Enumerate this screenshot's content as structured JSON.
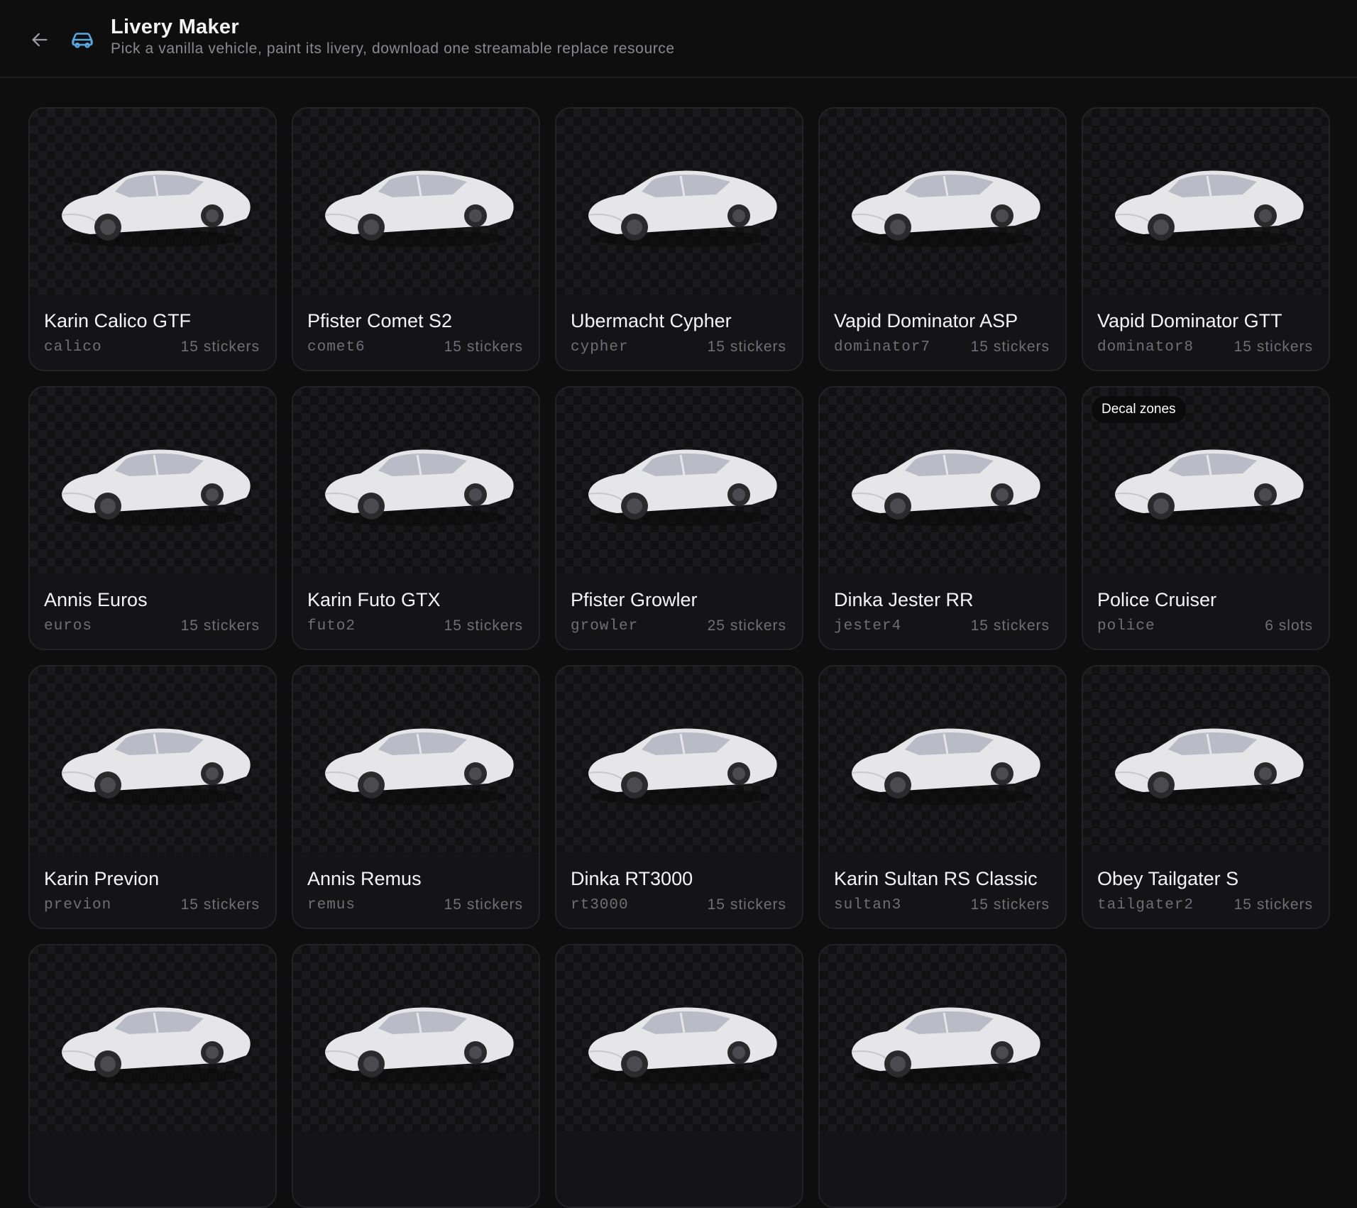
{
  "header": {
    "title": "Livery Maker",
    "subtitle": "Pick a vanilla vehicle, paint its livery, download one streamable replace resource",
    "back_icon": "arrow-left-icon",
    "app_icon": "car-icon",
    "accent_color": "#5aa7e0"
  },
  "vehicles": [
    {
      "name": "Karin Calico GTF",
      "model": "calico",
      "count": "15 stickers",
      "badge": ""
    },
    {
      "name": "Pfister Comet S2",
      "model": "comet6",
      "count": "15 stickers",
      "badge": ""
    },
    {
      "name": "Ubermacht Cypher",
      "model": "cypher",
      "count": "15 stickers",
      "badge": ""
    },
    {
      "name": "Vapid Dominator ASP",
      "model": "dominator7",
      "count": "15 stickers",
      "badge": ""
    },
    {
      "name": "Vapid Dominator GTT",
      "model": "dominator8",
      "count": "15 stickers",
      "badge": ""
    },
    {
      "name": "Annis Euros",
      "model": "euros",
      "count": "15 stickers",
      "badge": ""
    },
    {
      "name": "Karin Futo GTX",
      "model": "futo2",
      "count": "15 stickers",
      "badge": ""
    },
    {
      "name": "Pfister Growler",
      "model": "growler",
      "count": "25 stickers",
      "badge": ""
    },
    {
      "name": "Dinka Jester RR",
      "model": "jester4",
      "count": "15 stickers",
      "badge": ""
    },
    {
      "name": "Police Cruiser",
      "model": "police",
      "count": "6 slots",
      "badge": "Decal zones"
    },
    {
      "name": "Karin Previon",
      "model": "previon",
      "count": "15 stickers",
      "badge": ""
    },
    {
      "name": "Annis Remus",
      "model": "remus",
      "count": "15 stickers",
      "badge": ""
    },
    {
      "name": "Dinka RT3000",
      "model": "rt3000",
      "count": "15 stickers",
      "badge": ""
    },
    {
      "name": "Karin Sultan RS Classic",
      "model": "sultan3",
      "count": "15 stickers",
      "badge": ""
    },
    {
      "name": "Obey Tailgater S",
      "model": "tailgater2",
      "count": "15 stickers",
      "badge": ""
    },
    {
      "name": "",
      "model": "",
      "count": "",
      "badge": ""
    },
    {
      "name": "",
      "model": "",
      "count": "",
      "badge": ""
    },
    {
      "name": "",
      "model": "",
      "count": "",
      "badge": ""
    },
    {
      "name": "",
      "model": "",
      "count": "",
      "badge": ""
    }
  ]
}
